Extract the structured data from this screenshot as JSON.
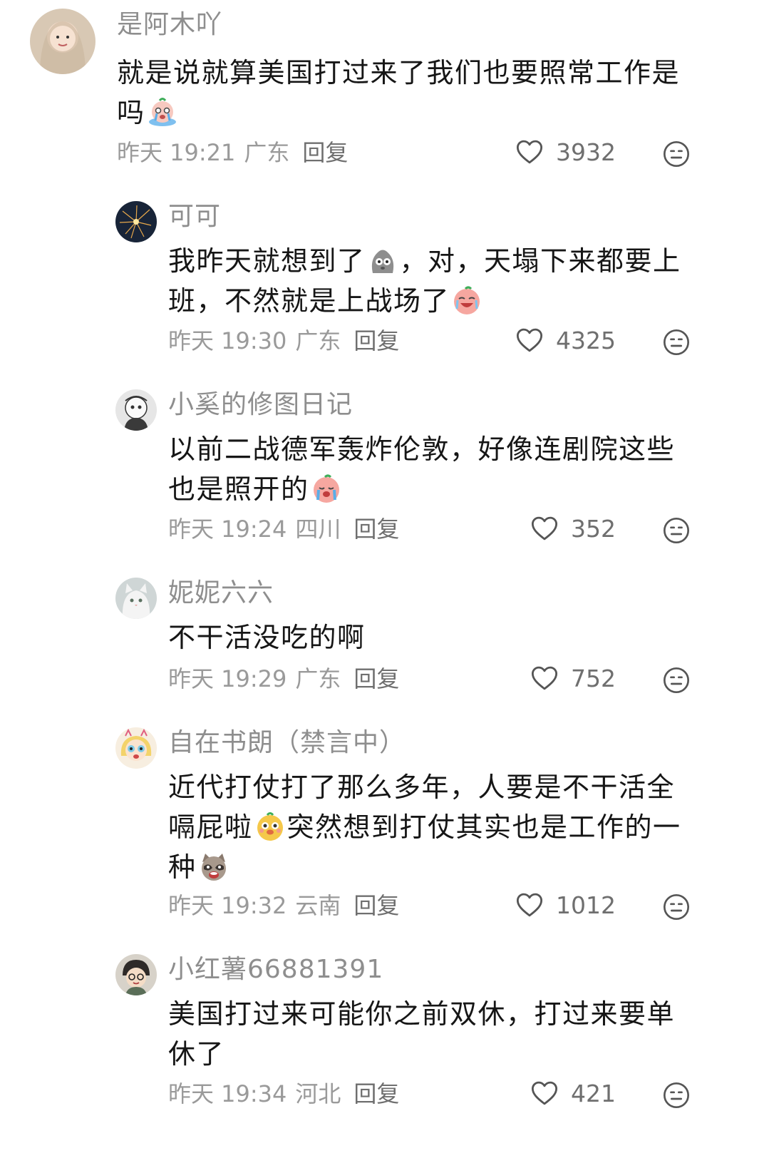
{
  "comments": [
    {
      "user": "是阿木吖",
      "text_parts": [
        "就是说就算美国打过来了我们也要照常工作是吗"
      ],
      "time": "昨天 19:21",
      "location": "广东",
      "reply": "回复",
      "likes": "3932"
    },
    {
      "user": "可可",
      "text_parts": [
        "我昨天就想到了",
        "，对，天塌下来都要上班，不然就是上战场了"
      ],
      "time": "昨天 19:30",
      "location": "广东",
      "reply": "回复",
      "likes": "4325"
    },
    {
      "user": "小奚的修图日记",
      "text_parts": [
        "以前二战德军轰炸伦敦，好像连剧院这些也是照开的"
      ],
      "time": "昨天 19:24",
      "location": "四川",
      "reply": "回复",
      "likes": "352"
    },
    {
      "user": "妮妮六六",
      "text_parts": [
        "不干活没吃的啊"
      ],
      "time": "昨天 19:29",
      "location": "广东",
      "reply": "回复",
      "likes": "752"
    },
    {
      "user": "自在书朗（禁言中）",
      "text_parts": [
        "近代打仗打了那么多年，人要是不干活全嗝屁啦",
        "突然想到打仗其实也是工作的一种"
      ],
      "time": "昨天 19:32",
      "location": "云南",
      "reply": "回复",
      "likes": "1012"
    },
    {
      "user": "小红薯66881391",
      "text_parts": [
        "美国打过来可能你之前双休，打过来要单休了"
      ],
      "time": "昨天 19:34",
      "location": "河北",
      "reply": "回复",
      "likes": "421"
    }
  ],
  "icons": {
    "like": "heart-outline-icon",
    "dislike": "neutral-face-icon"
  },
  "colors": {
    "text": "#161616",
    "secondary": "#8e8e8e",
    "meta": "#9a9a9a"
  }
}
